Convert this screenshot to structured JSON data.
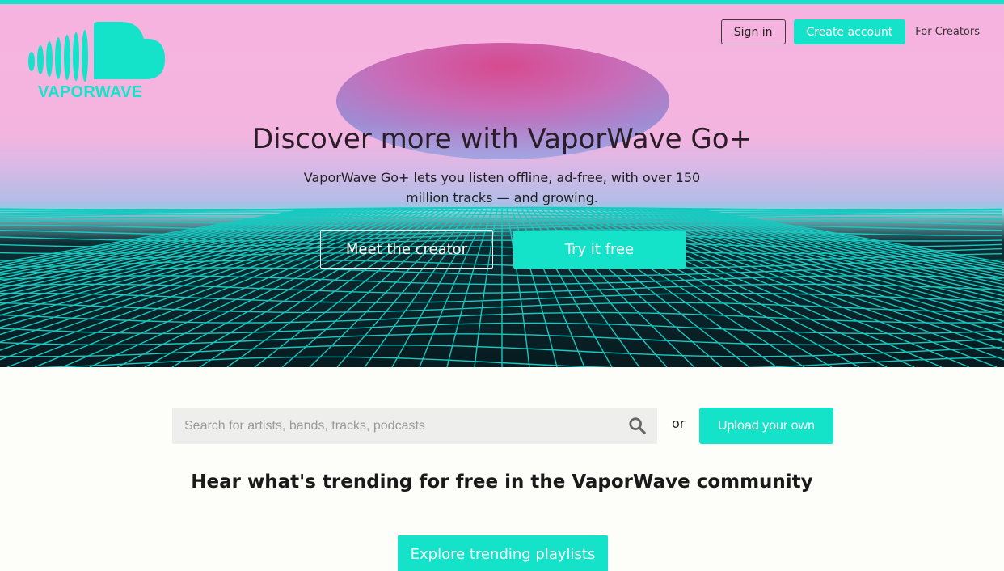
{
  "brand": {
    "name": "VAPORWAVE",
    "accent_color": "#15e3c9",
    "logo_icon": "cloud-soundwave-icon"
  },
  "nav": {
    "sign_in": "Sign in",
    "create_account": "Create account",
    "for_creators": "For Creators"
  },
  "hero": {
    "title": "Discover more with VaporWave Go+",
    "subtitle": "VaporWave Go+ lets you listen offline, ad-free, with over 150 million tracks — and growing.",
    "meet_creator": "Meet the creator",
    "try_free": "Try it free",
    "background": "vaporwave-grid-landscape"
  },
  "search": {
    "placeholder": "Search for artists, bands, tracks, podcasts",
    "value": "",
    "icon": "search-icon"
  },
  "or_text": "or",
  "upload_button": "Upload your own",
  "trending": {
    "heading": "Hear what's trending for free in the VaporWave community",
    "explore_button": "Explore trending playlists"
  }
}
